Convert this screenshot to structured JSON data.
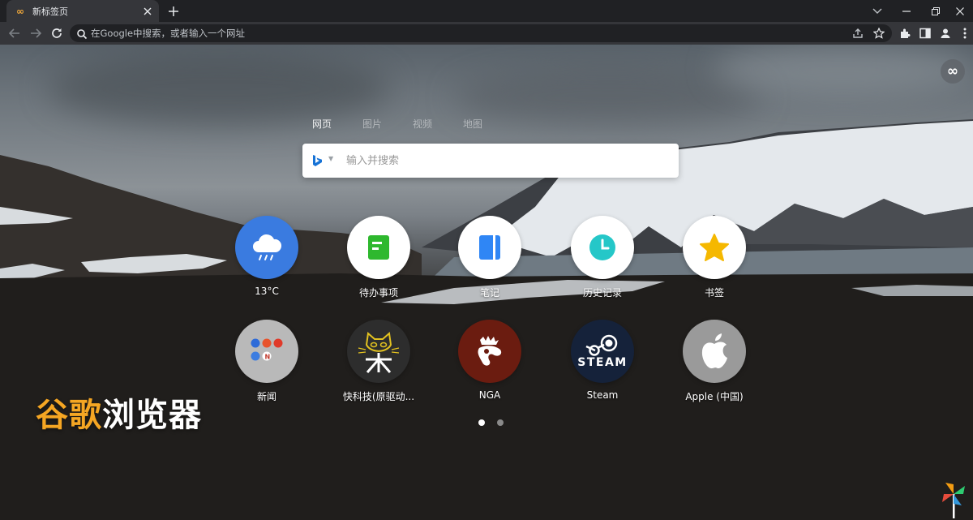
{
  "tab": {
    "title": "新标签页",
    "favicon": "infinity-icon"
  },
  "omnibox": {
    "placeholder": "在Google中搜索，或者输入一个网址"
  },
  "search": {
    "tabs": [
      "网页",
      "图片",
      "视频",
      "地图"
    ],
    "active_tab": "网页",
    "placeholder": "输入并搜索",
    "engine": "bing-icon"
  },
  "shortcuts": [
    {
      "label": "13°C",
      "icon": "weather-cloud-icon",
      "bg": "#3a7be0"
    },
    {
      "label": "待办事项",
      "icon": "todo-icon",
      "bg": "#ffffff"
    },
    {
      "label": "笔记",
      "icon": "notes-icon",
      "bg": "#ffffff"
    },
    {
      "label": "历史记录",
      "icon": "history-clock-icon",
      "bg": "#ffffff"
    },
    {
      "label": "书签",
      "icon": "bookmark-star-icon",
      "bg": "#ffffff"
    },
    {
      "label": "新闻",
      "icon": "news-folder-icon",
      "bg": "#b9b9b9"
    },
    {
      "label": "快科技(原驱动...",
      "icon": "mydrivers-cat-icon",
      "bg": "#2d2d2d"
    },
    {
      "label": "NGA",
      "icon": "nga-paw-icon",
      "bg": "#6b1c10"
    },
    {
      "label": "Steam",
      "icon": "steam-icon",
      "bg": "#15223a",
      "text": "STEAM"
    },
    {
      "label": "Apple (中国)",
      "icon": "apple-icon",
      "bg": "#9a9a9a"
    }
  ],
  "pagination": {
    "pages": 2,
    "current": 1
  },
  "watermark": {
    "accent": "谷歌",
    "rest": "浏览器"
  },
  "colors": {
    "accent": "#f5a623",
    "weather": "#3a7be0",
    "todo": "#2eb82e",
    "notes": "#2f86f5",
    "history": "#25c7c8",
    "bookmark": "#f5b800"
  }
}
